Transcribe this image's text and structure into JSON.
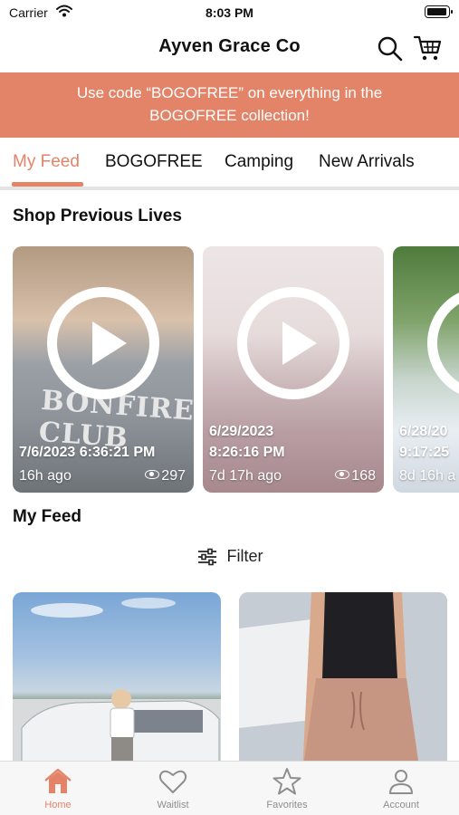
{
  "status_bar": {
    "carrier": "Carrier",
    "time": "8:03 PM"
  },
  "header": {
    "title": "Ayven Grace Co",
    "search_icon": "search-icon",
    "cart_icon": "cart-icon"
  },
  "promo": {
    "text": "Use code “BOGOFREE” on everything in the BOGOFREE collection!"
  },
  "tabs": [
    {
      "label": "My Feed",
      "active": true
    },
    {
      "label": "BOGOFREE",
      "active": false
    },
    {
      "label": "Camping",
      "active": false
    },
    {
      "label": "New Arrivals",
      "active": false
    }
  ],
  "sections": {
    "lives_title": "Shop Previous Lives",
    "feed_title": "My Feed"
  },
  "lives": [
    {
      "date": "7/6/2023 6:36:21 PM",
      "ago": "16h ago",
      "views": "297",
      "shirt_text": "BONFIRE CLUB"
    },
    {
      "date": "6/29/2023",
      "time": "8:26:16 PM",
      "ago": "7d 17h ago",
      "views": "168"
    },
    {
      "date": "6/28/20",
      "time": "9:17:25",
      "ago": "8d 16h a"
    }
  ],
  "filter": {
    "label": "Filter",
    "icon": "sliders-icon"
  },
  "tabbar": [
    {
      "label": "Home",
      "icon": "home-icon",
      "active": true
    },
    {
      "label": "Waitlist",
      "icon": "heart-icon",
      "active": false
    },
    {
      "label": "Favorites",
      "icon": "star-icon",
      "active": false
    },
    {
      "label": "Account",
      "icon": "person-icon",
      "active": false
    }
  ],
  "colors": {
    "accent": "#e38468",
    "inactive": "#8e8e8e"
  }
}
